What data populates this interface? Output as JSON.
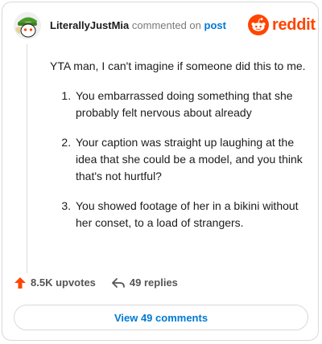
{
  "header": {
    "username": "LiterallyJustMia",
    "action": "commented on",
    "target": "post",
    "brand": "reddit",
    "brand_color": "#ff4500"
  },
  "comment": {
    "intro": "YTA man, I can't imagine if someone did this to me.",
    "points": [
      "You embarrassed doing something that she probably felt nervous about already",
      "Your caption was straight up laughing at the idea that she could be a model, and you think that's not hurtful?",
      "You showed footage of her in a bikini without her conset, to a load of strangers."
    ]
  },
  "footer": {
    "upvotes": "8.5K upvotes",
    "replies": "49 replies",
    "upvote_icon": "arrow-up-icon",
    "reply_icon": "reply-arrow-icon",
    "upvote_color": "#ff4500"
  },
  "view_button": "View 49 comments"
}
